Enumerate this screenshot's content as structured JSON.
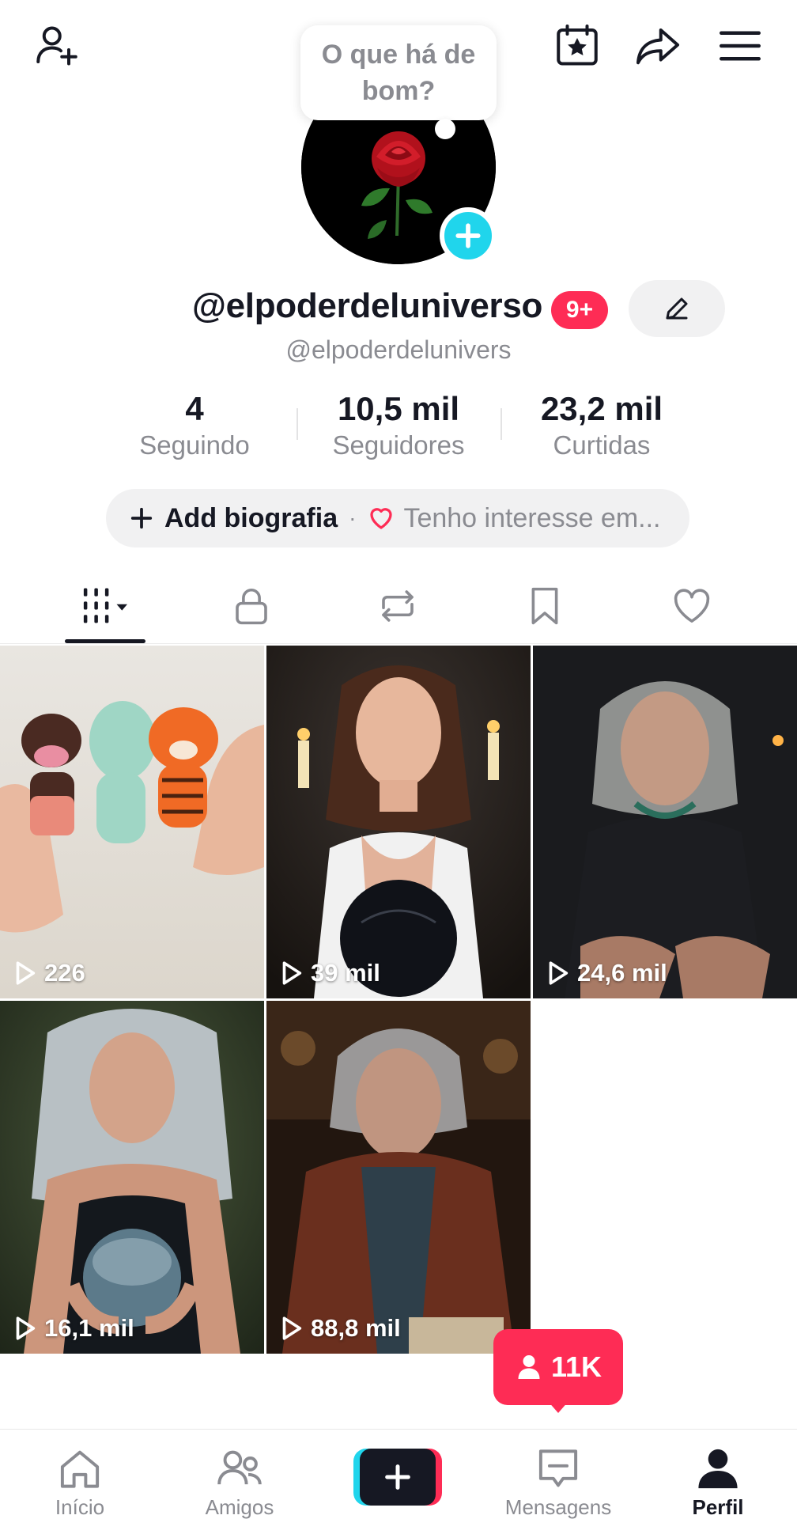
{
  "header": {
    "bubble_text": "O que há de bom?",
    "icons": [
      "add-friend-icon",
      "calendar-star-icon",
      "share-icon",
      "menu-icon"
    ]
  },
  "profile": {
    "username": "@elpoderdeluniverso",
    "notification_badge": "9+",
    "handle": "@elpoderdelunivers",
    "stats": [
      {
        "value": "4",
        "label": "Seguindo"
      },
      {
        "value": "10,5 mil",
        "label": "Seguidores"
      },
      {
        "value": "23,2 mil",
        "label": "Curtidas"
      }
    ],
    "bio_add": "Add biografia",
    "bio_separator": "·",
    "bio_interest": "Tenho interesse em..."
  },
  "tabs": [
    "videos-grid-icon",
    "lock-icon",
    "repost-icon",
    "bookmark-icon",
    "heart-icon"
  ],
  "videos": [
    {
      "views": "226",
      "theme": "crochet toys"
    },
    {
      "views": "39 mil",
      "theme": "woman with crystal ball"
    },
    {
      "views": "24,6 mil",
      "theme": "old woman dark"
    },
    {
      "views": "16,1 mil",
      "theme": "woman holding glass sphere"
    },
    {
      "views": "88,8 mil",
      "theme": "old fortune teller"
    }
  ],
  "follower_popup": "11K",
  "bottom_nav": [
    {
      "label": "Início",
      "icon": "home-icon"
    },
    {
      "label": "Amigos",
      "icon": "friends-icon"
    },
    {
      "label": "",
      "icon": "create-plus-icon"
    },
    {
      "label": "Mensagens",
      "icon": "inbox-icon"
    },
    {
      "label": "Perfil",
      "icon": "profile-icon",
      "active": true
    }
  ],
  "colors": {
    "accent_red": "#fe2c55",
    "accent_cyan": "#20d5ec",
    "text_primary": "#161823",
    "text_secondary": "#8a8b91"
  }
}
